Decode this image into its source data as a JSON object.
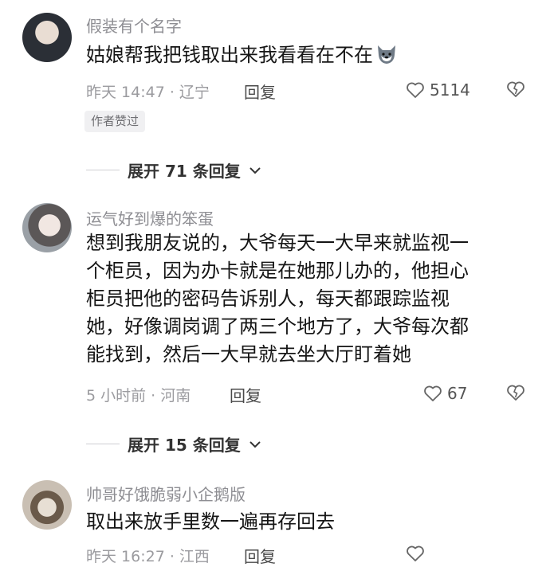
{
  "comments": [
    {
      "username": "假装有个名字",
      "content": "姑娘帮我把钱取出来我看看在不在",
      "time_location": "昨天 14:47 · 辽宁",
      "reply_label": "回复",
      "likes": "5114",
      "badge": "作者赞过",
      "expand_label": "展开 71 条回复",
      "emoji": "wolf-face"
    },
    {
      "username": "运气好到爆的笨蛋",
      "content_lines": [
        "想到我朋友说的，大爷每天一大早来就监视一",
        "个柜员，因为办卡就是在她那儿办的，他担心",
        "柜员把他的密码告诉别人，每天都跟踪监视",
        "她，好像调岗调了两三个地方了，大爷每次都",
        "能找到，然后一大早就去坐大厅盯着她"
      ],
      "time_location": "5 小时前 · 河南",
      "reply_label": "回复",
      "likes": "67",
      "expand_label": "展开 15 条回复"
    },
    {
      "username": "帅哥好饿脆弱小企鹅版",
      "content": "取出来放手里数一遍再存回去",
      "time_location": "昨天 16:27 · 江西",
      "reply_label": "回复"
    }
  ],
  "icons": {
    "like": "heart-outline-icon",
    "dislike": "broken-heart-icon",
    "expand": "chevron-down-icon"
  }
}
